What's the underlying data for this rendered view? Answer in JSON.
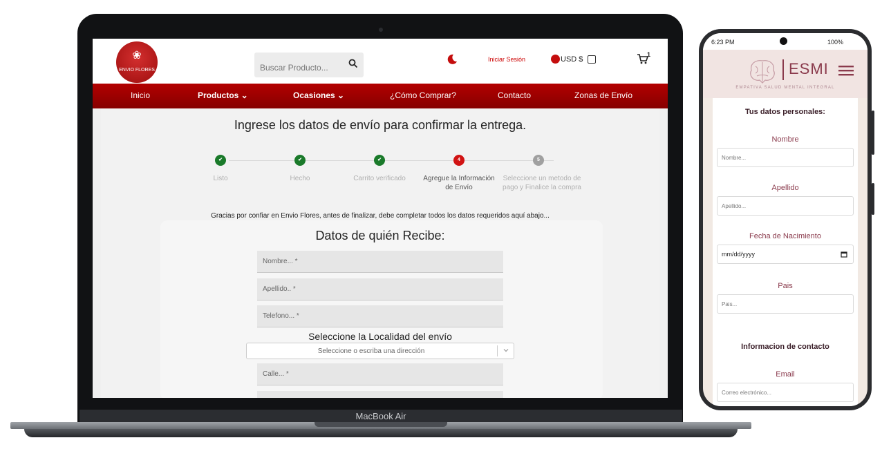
{
  "laptop": {
    "device_label": "MacBook Air",
    "header": {
      "logo_text": "ENVIO FLORES",
      "search_placeholder": "Buscar Producto...",
      "login_label": "Iniciar Sesión",
      "currency_label": "USD $",
      "cart_count": "1"
    },
    "nav": {
      "items": [
        "Inicio",
        "Productos ⌄",
        "Ocasiones ⌄",
        "¿Cómo Comprar?",
        "Contacto",
        "Zonas de Envío"
      ]
    },
    "page": {
      "heading": "Ingrese los datos de envío para confirmar la entrega.",
      "steps": [
        {
          "label": "Listo",
          "state": "done"
        },
        {
          "label": "Hecho",
          "state": "done"
        },
        {
          "label": "Carrito verificado",
          "state": "done"
        },
        {
          "label": "Agregue la Información de Envío",
          "state": "active",
          "number": "4"
        },
        {
          "label": "Seleccione un metodo de pago y Finalice la compra",
          "state": "todo",
          "number": "5"
        }
      ],
      "thanks_text": "Gracias por confiar en Envio Flores, antes de finalizar, debe completar todos los datos requeridos aquí abajo...",
      "form_title": "Datos de quién Recibe:",
      "fields": {
        "nombre": "Nombre... *",
        "apellido": "Apellido.. *",
        "telefono": "Telefono... *",
        "calle": "Calle... *"
      },
      "locality_title": "Seleccione la Localidad del envío",
      "locality_placeholder": "Seleccione o escriba una dirección"
    },
    "colors": {
      "brand_red": "#b30000",
      "done_green": "#1a7a2a",
      "active_red": "#d11313"
    }
  },
  "phone": {
    "status": {
      "time": "6:23 PM",
      "battery": "100%"
    },
    "header": {
      "brand": "ESMI",
      "tagline": "EMPATIVA SALUD MENTAL INTEGRAL"
    },
    "form": {
      "section_personal": "Tus datos personales:",
      "nombre_label": "Nombre",
      "nombre_placeholder": "Nombre...",
      "apellido_label": "Apellido",
      "apellido_placeholder": "Apellido...",
      "fecha_label": "Fecha de Nacimiento",
      "fecha_value": "mm/dd/yyyy",
      "pais_label": "Pais",
      "pais_placeholder": "Pais...",
      "section_contact": "Informacion de contacto",
      "email_label": "Email",
      "email_placeholder": "Correo electrónico..."
    },
    "colors": {
      "brand": "#8a3a4c",
      "header_bg": "#f1e4e2"
    }
  }
}
